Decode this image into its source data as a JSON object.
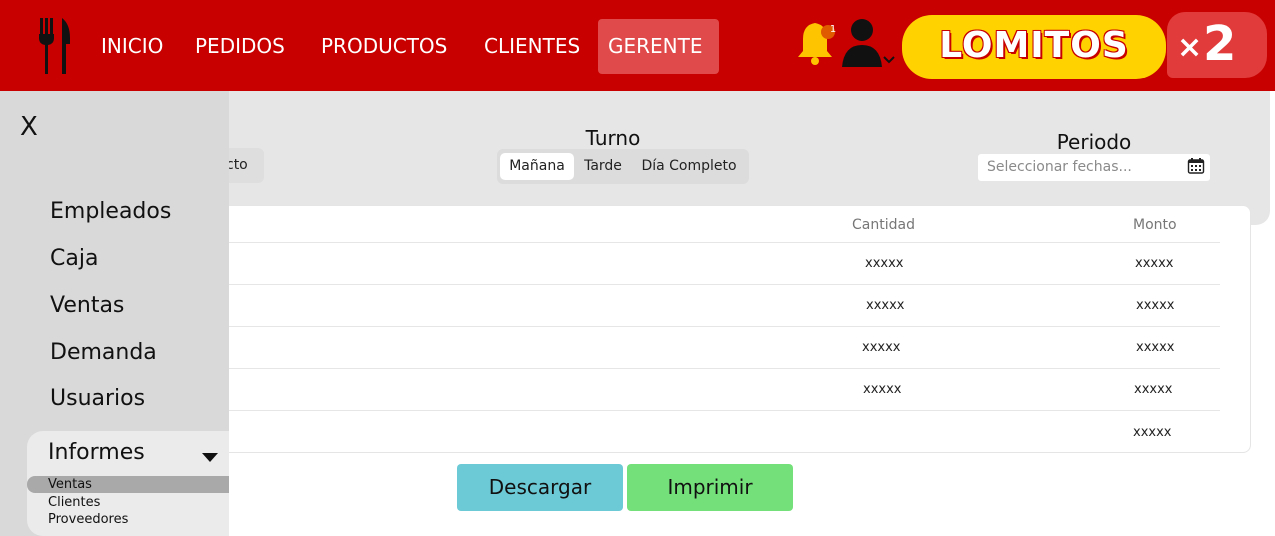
{
  "header": {
    "nav": [
      "INICIO",
      "PEDIDOS",
      "PRODUCTOS",
      "CLIENTES",
      "GERENTE"
    ],
    "active_nav": "GERENTE",
    "notification_count": "1",
    "brand": "LOMITOS",
    "promo": {
      "times": "×",
      "number": "2"
    }
  },
  "filters": {
    "producto_partial": "cto",
    "turno": {
      "title": "Turno",
      "options": [
        "Mañana",
        "Tarde",
        "Día Completo"
      ],
      "selected": "Mañana"
    },
    "periodo": {
      "title": "Periodo",
      "placeholder": "Seleccionar fechas..."
    }
  },
  "table": {
    "headers": [
      "Cantidad",
      "Monto"
    ],
    "rows": [
      {
        "cantidad": "xxxxx",
        "monto": "xxxxx"
      },
      {
        "cantidad": "xxxxx",
        "monto": "xxxxx"
      },
      {
        "cantidad": "xxxxx",
        "monto": "xxxxx"
      },
      {
        "cantidad": "xxxxx",
        "monto": "xxxxx"
      },
      {
        "cantidad": "",
        "monto": "xxxxx"
      }
    ]
  },
  "actions": {
    "download": "Descargar",
    "print": "Imprimir"
  },
  "sidebar": {
    "close": "X",
    "items": [
      "Empleados",
      "Caja",
      "Ventas",
      "Demanda",
      "Usuarios"
    ],
    "section": {
      "label": "Informes",
      "subitems": [
        "Ventas",
        "Clientes",
        "Proveedores"
      ],
      "selected": "Ventas"
    }
  },
  "colors": {
    "header_bg": "#c80000",
    "brand_yellow": "#ffd200",
    "download_button": "#6ccad6",
    "print_button": "#74e07a",
    "sidebar_bg": "#d9d9d9"
  },
  "icons": [
    "fork-knife-icon",
    "bell-icon",
    "user-icon",
    "chevron-down-icon",
    "calendar-icon",
    "caret-down-icon"
  ]
}
